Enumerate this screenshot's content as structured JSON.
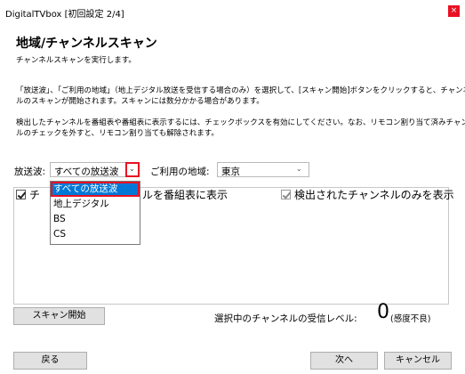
{
  "window": {
    "title": "DigitalTVbox [初回設定 2/4]",
    "close_label": "×"
  },
  "heading": "地域/チャンネルスキャン",
  "description": {
    "line1": "チャンネルスキャンを実行します。",
    "para2_line1": "「放送波」、「ご利用の地域」（地上デジタル放送を受信する場合のみ）を選択して、[スキャン開始]ボタンをクリックすると、チャンネ",
    "para2_line2": "ルのスキャンが開始されます。スキャンには数分かかる場合があります。",
    "para3_line1": "検出したチャンネルを番組表や番組表に表示するには、チェックボックスを有効にしてください。なお、リモコン割り当て済みチャンネ",
    "para3_line2": "ルのチェックを外すと、リモコン割り当ても解除されます。"
  },
  "broadcast": {
    "label": "放送波:",
    "value": "すべての放送波",
    "options": [
      "すべての放送波",
      "地上デジタル",
      "BS",
      "CS"
    ]
  },
  "region": {
    "label": "ご利用の地域:",
    "value": "東京"
  },
  "checkboxes": {
    "show_in_guide_prefix": "チ",
    "show_in_guide_suffix": "ルを番組表に表示",
    "show_detected_only": "検出されたチャンネルのみを表示"
  },
  "scan_button": "スキャン開始",
  "signal": {
    "label": "選択中のチャンネルの受信レベル:",
    "value": "0",
    "status": "(感度不良)"
  },
  "buttons": {
    "back": "戻る",
    "next": "次へ",
    "cancel": "キャンセル"
  },
  "colors": {
    "highlight": "#0078d7",
    "annotation_red": "#e81123"
  }
}
